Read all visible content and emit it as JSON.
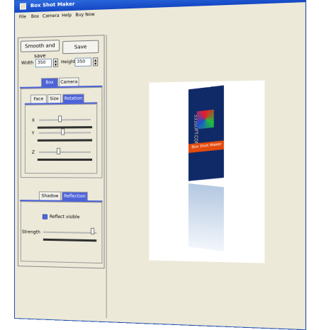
{
  "window": {
    "title": "Box Shot Maker"
  },
  "menu": [
    "File",
    "Box",
    "Camera",
    "Help",
    "Buy Now"
  ],
  "toolbar": {
    "smooth_save": "Smooth and save",
    "save": "Save"
  },
  "dimensions": {
    "width_label": "Width",
    "width_value": "350",
    "height_label": "Height",
    "height_value": "350"
  },
  "main_tabs": [
    "Box",
    "Camera"
  ],
  "sub_tabs": [
    "Face",
    "Size",
    "Rotation"
  ],
  "rotation": {
    "x_label": "X",
    "y_label": "Y",
    "z_label": "Z"
  },
  "effects_tabs": [
    "Shadow",
    "Reflection"
  ],
  "reflection": {
    "checkbox_label": "Reflect visible",
    "strength_label": "Strength"
  },
  "box_cover": {
    "spine_text": "533SOFT.COM",
    "stripe_text": "Box Shot Maker"
  },
  "colors": {
    "title_blue": "#1447c4",
    "tab_active": "#4d63d8",
    "box_navy": "#102a68",
    "box_orange": "#e34a0d"
  }
}
